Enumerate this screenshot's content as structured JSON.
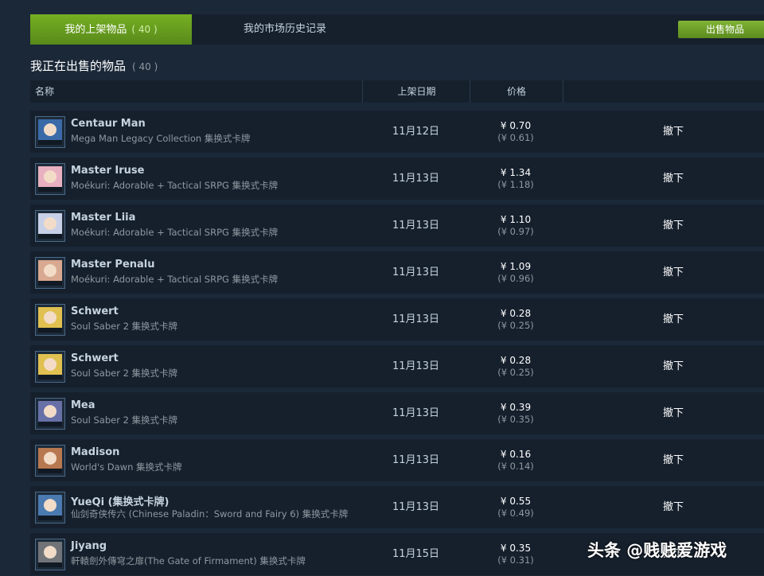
{
  "tabs": {
    "active_label": "我的上架物品",
    "active_count": "( 40 )",
    "inactive_label": "我的市场历史记录"
  },
  "sell_button": "出售物品",
  "section": {
    "title": "我正在出售的物品",
    "count": "( 40 )"
  },
  "columns": {
    "name": "名称",
    "date": "上架日期",
    "price": "价格"
  },
  "listings": [
    {
      "name": "Centaur Man",
      "game": "Mega Man Legacy Collection 集换式卡牌",
      "date": "11月12日",
      "price": "¥ 0.70",
      "price_net": "(¥ 0.61)",
      "action": "撤下",
      "icon_color": "#3a6aa8",
      "icon_name": "centaur-man-card-icon"
    },
    {
      "name": "Master Iruse",
      "game": "Moékuri: Adorable + Tactical SRPG 集换式卡牌",
      "date": "11月13日",
      "price": "¥ 1.34",
      "price_net": "(¥ 1.18)",
      "action": "撤下",
      "icon_color": "#e8b0c0",
      "icon_name": "master-iruse-card-icon"
    },
    {
      "name": "Master Liia",
      "game": "Moékuri: Adorable + Tactical SRPG 集换式卡牌",
      "date": "11月13日",
      "price": "¥ 1.10",
      "price_net": "(¥ 0.97)",
      "action": "撤下",
      "icon_color": "#c8d0e8",
      "icon_name": "master-liia-card-icon"
    },
    {
      "name": "Master Penalu",
      "game": "Moékuri: Adorable + Tactical SRPG 集换式卡牌",
      "date": "11月13日",
      "price": "¥ 1.09",
      "price_net": "(¥ 0.96)",
      "action": "撤下",
      "icon_color": "#d8a890",
      "icon_name": "master-penalu-card-icon"
    },
    {
      "name": "Schwert",
      "game": "Soul Saber 2 集换式卡牌",
      "date": "11月13日",
      "price": "¥ 0.28",
      "price_net": "(¥ 0.25)",
      "action": "撤下",
      "icon_color": "#e0c050",
      "icon_name": "schwert-card-icon"
    },
    {
      "name": "Schwert",
      "game": "Soul Saber 2 集换式卡牌",
      "date": "11月13日",
      "price": "¥ 0.28",
      "price_net": "(¥ 0.25)",
      "action": "撤下",
      "icon_color": "#e0c050",
      "icon_name": "schwert-card-icon"
    },
    {
      "name": "Mea",
      "game": "Soul Saber 2 集换式卡牌",
      "date": "11月13日",
      "price": "¥ 0.39",
      "price_net": "(¥ 0.35)",
      "action": "撤下",
      "icon_color": "#6870a8",
      "icon_name": "mea-card-icon"
    },
    {
      "name": "Madison",
      "game": "World's Dawn 集换式卡牌",
      "date": "11月13日",
      "price": "¥ 0.16",
      "price_net": "(¥ 0.14)",
      "action": "撤下",
      "icon_color": "#b87850",
      "icon_name": "madison-card-icon"
    },
    {
      "name": "YueQi (集换式卡牌)",
      "game": "仙剑奇侠传六 (Chinese Paladin：Sword and Fairy 6) 集换式卡牌",
      "date": "11月13日",
      "price": "¥ 0.55",
      "price_net": "(¥ 0.49)",
      "action": "撤下",
      "icon_color": "#4a7ab0",
      "icon_name": "yueqi-card-icon"
    },
    {
      "name": "Jiyang",
      "game": "軒轅劍外傳穹之扉(The Gate of Firmament) 集换式卡牌",
      "date": "11月15日",
      "price": "¥ 0.35",
      "price_net": "(¥ 0.31)",
      "action": "撤下",
      "icon_color": "#707478",
      "icon_name": "jiyang-card-icon"
    }
  ],
  "watermark": "头条 @贱贱爱游戏"
}
